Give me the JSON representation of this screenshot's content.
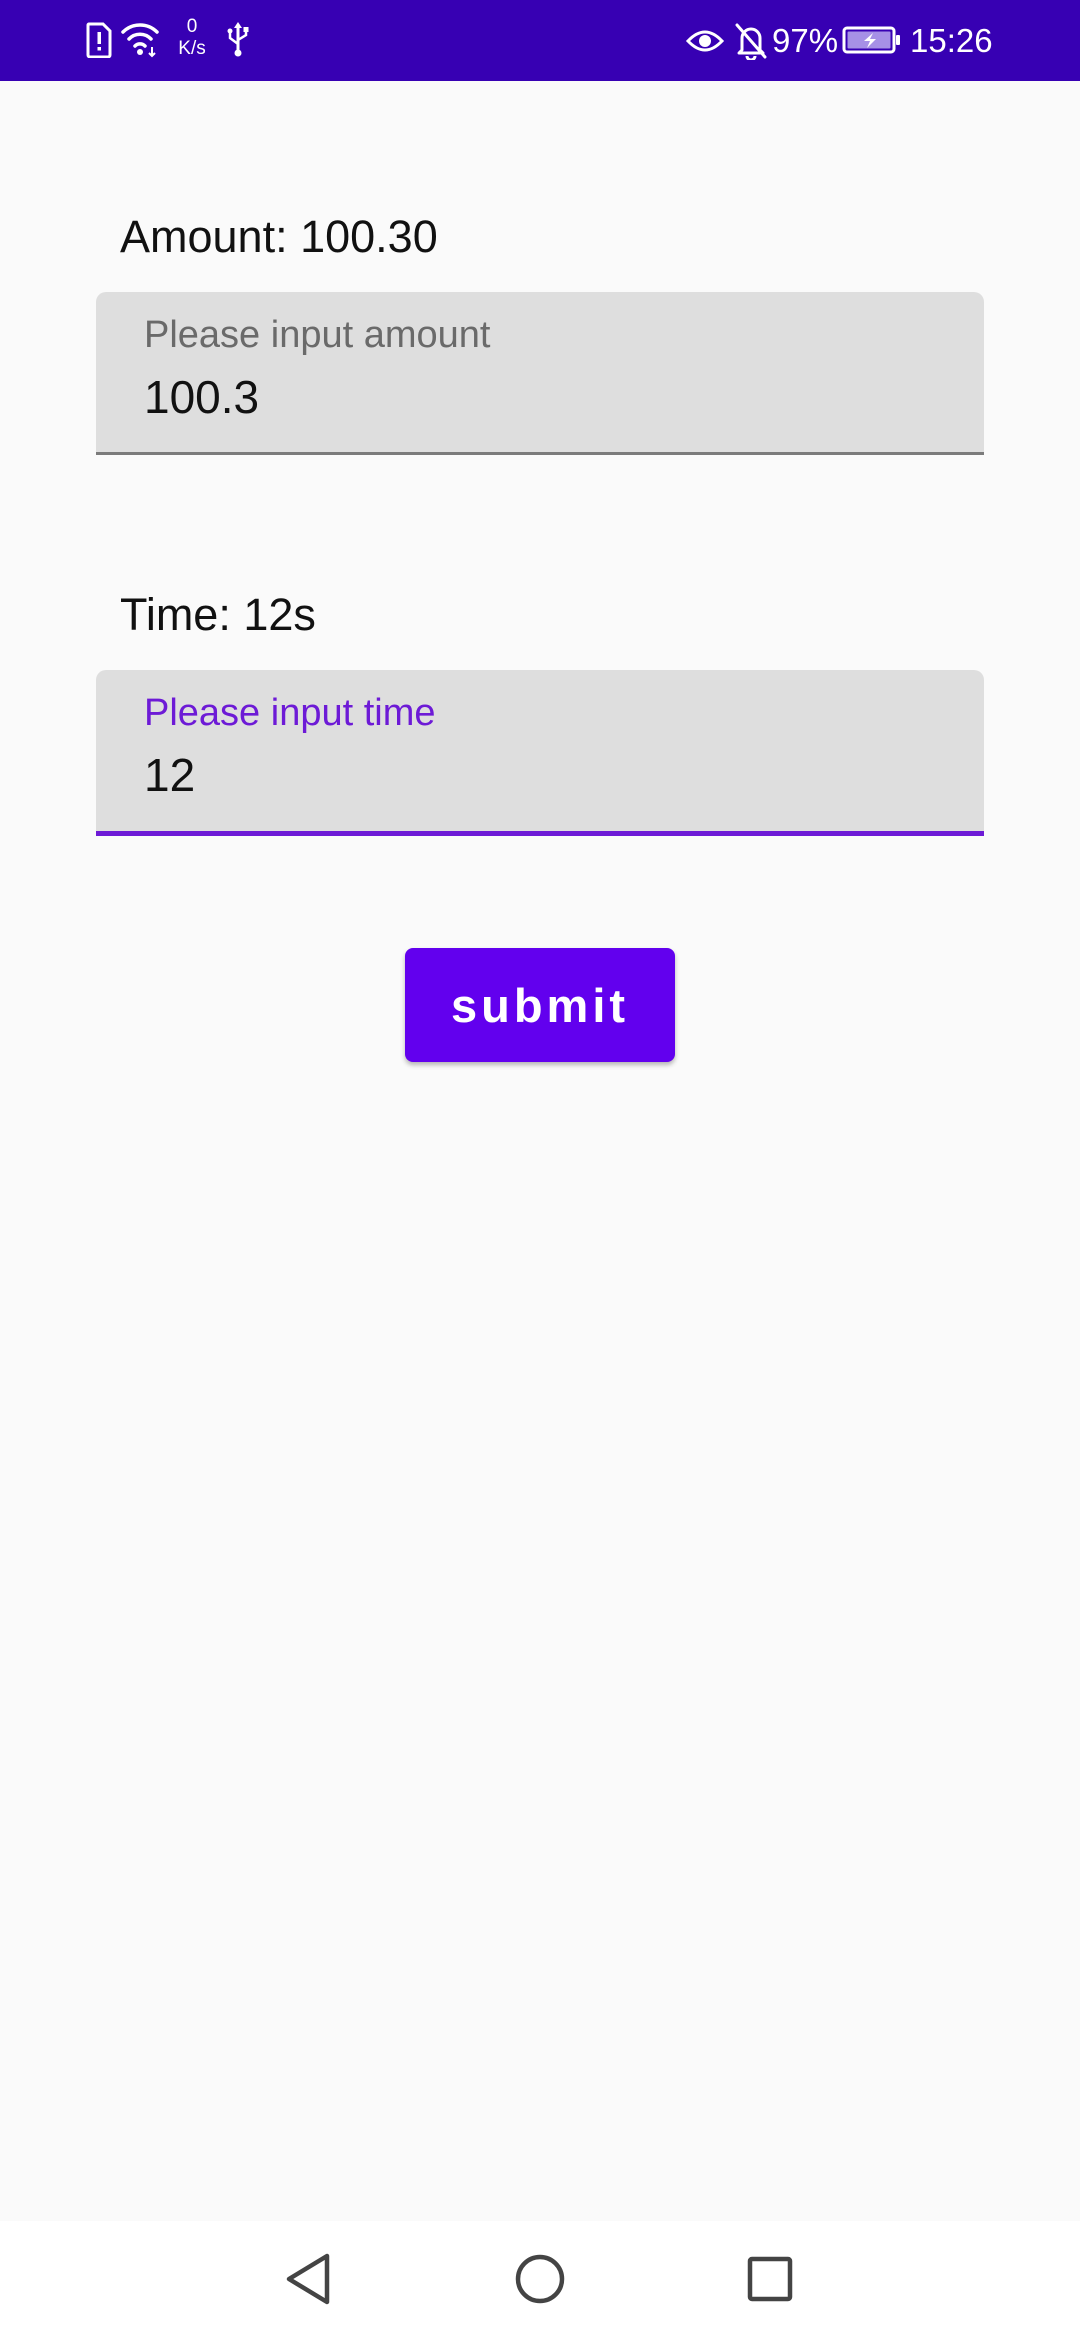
{
  "status_bar": {
    "network_speed_value": "0",
    "network_speed_unit": "K/s",
    "battery": "97%",
    "time": "15:26",
    "icons": [
      "sim-alert-icon",
      "wifi-icon",
      "usb-icon",
      "eye-icon",
      "bell-off-icon",
      "battery-charging-icon"
    ]
  },
  "amount": {
    "label": "Amount: 100.30",
    "placeholder": "Please input amount",
    "value": "100.3"
  },
  "time": {
    "label": "Time: 12s",
    "placeholder": "Please input time",
    "value": "12"
  },
  "submit": {
    "label": "submit"
  },
  "nav_bar": {
    "icons": [
      "back-icon",
      "home-icon",
      "recents-icon"
    ]
  },
  "colors": {
    "status_bar": "#3700b3",
    "primary": "#6200ee",
    "focused_accent": "#6d1ad6",
    "field_background": "#dedede",
    "background": "#fafafa"
  }
}
